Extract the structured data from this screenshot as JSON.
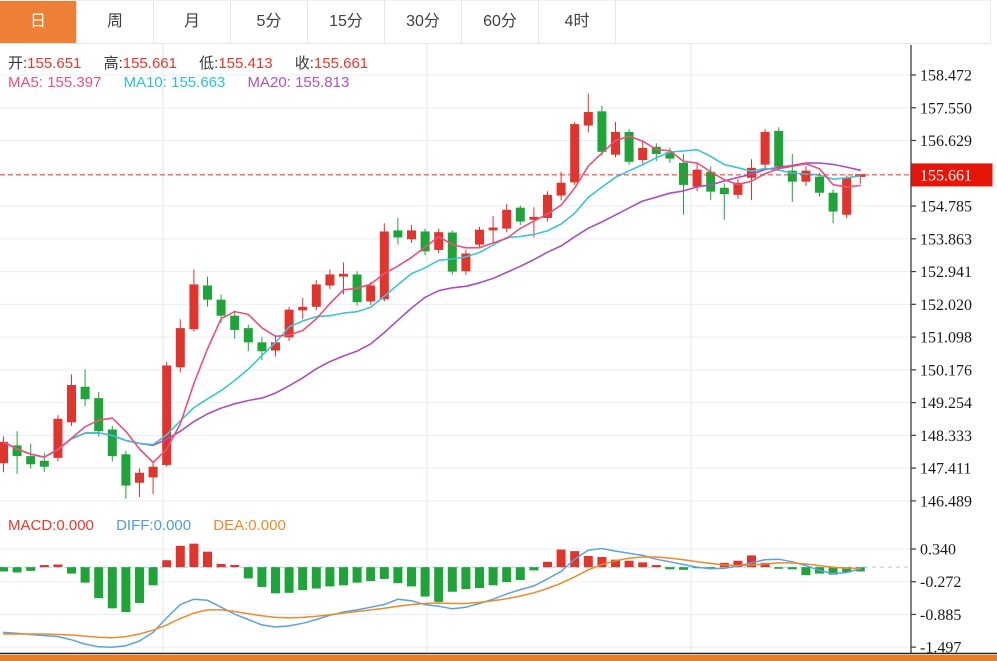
{
  "tabs": {
    "items": [
      {
        "key": "day",
        "label": "日",
        "active": true
      },
      {
        "key": "week",
        "label": "周",
        "active": false
      },
      {
        "key": "month",
        "label": "月",
        "active": false
      },
      {
        "key": "5min",
        "label": "5分",
        "active": false
      },
      {
        "key": "15min",
        "label": "15分",
        "active": false
      },
      {
        "key": "30min",
        "label": "30分",
        "active": false
      },
      {
        "key": "60min",
        "label": "60分",
        "active": false
      },
      {
        "key": "4hour",
        "label": "4时",
        "active": false
      }
    ]
  },
  "legend": {
    "open_label": "开:",
    "open_value": "155.651",
    "high_label": "高:",
    "high_value": "155.661",
    "low_label": "低:",
    "low_value": "155.413",
    "close_label": "收:",
    "close_value": "155.661",
    "ma5_label": "MA5: ",
    "ma5_value": "155.397",
    "ma10_label": "MA10: ",
    "ma10_value": "155.663",
    "ma20_label": "MA20: ",
    "ma20_value": "155.813"
  },
  "macd_legend": {
    "macd_label": "MACD:",
    "macd_value": "0.000",
    "diff_label": "DIFF:",
    "diff_value": "0.000",
    "dea_label": "DEA:",
    "dea_value": "0.000"
  },
  "colors": {
    "up": "#e0342c",
    "down": "#1fa439",
    "ma5": "#ee4f7c",
    "ma10": "#3bc4da",
    "ma20": "#aa4fc0",
    "diff": "#5aa2e6",
    "dea": "#ef8b26",
    "grid_h": "#e9eef6",
    "grid_v": "#dce6f4",
    "axis": "#3c3c3c",
    "axis_text": "#1b1b1b",
    "current_line": "#e23b31",
    "tag_red": "#e61507",
    "tag_text": "#ffffff",
    "zero_dash": "#a5d9ef",
    "accent_orange": "#ee7c1c",
    "bottom_border": "#222222"
  },
  "chart_data": {
    "type": "candlestick",
    "title": "",
    "legend_position": "top-left",
    "grid": true,
    "main": {
      "ylim": [
        146.489,
        158.472
      ],
      "tick_prices": [
        158.472,
        157.55,
        156.629,
        155.707,
        154.785,
        153.863,
        152.941,
        152.02,
        151.098,
        150.176,
        149.254,
        148.333,
        147.411,
        146.489
      ],
      "tick_labels": [
        "158.472",
        "157.550",
        "156.629",
        "",
        "154.785",
        "153.863",
        "152.941",
        "152.020",
        "151.098",
        "150.176",
        "149.254",
        "148.333",
        "147.411",
        "146.489"
      ],
      "current_price": 155.661,
      "current_price_label": "155.661",
      "candles_format": [
        "open",
        "high",
        "low",
        "close"
      ],
      "candles": [
        [
          147.55,
          148.3,
          147.3,
          148.15
        ],
        [
          148.05,
          148.45,
          147.25,
          147.75
        ],
        [
          147.75,
          148.1,
          147.4,
          147.52
        ],
        [
          147.62,
          147.85,
          147.3,
          147.45
        ],
        [
          147.7,
          148.9,
          147.6,
          148.8
        ],
        [
          148.7,
          150.05,
          148.6,
          149.75
        ],
        [
          149.7,
          150.18,
          149.15,
          149.35
        ],
        [
          149.38,
          149.55,
          148.3,
          148.45
        ],
        [
          148.5,
          148.6,
          147.6,
          147.75
        ],
        [
          147.8,
          147.9,
          146.55,
          146.92
        ],
        [
          147.0,
          147.4,
          146.6,
          147.28
        ],
        [
          147.15,
          147.55,
          146.68,
          147.45
        ],
        [
          147.5,
          150.4,
          147.45,
          150.3
        ],
        [
          150.25,
          151.6,
          150.1,
          151.35
        ],
        [
          151.32,
          153.0,
          151.25,
          152.58
        ],
        [
          152.55,
          152.8,
          151.95,
          152.15
        ],
        [
          152.15,
          152.3,
          151.5,
          151.7
        ],
        [
          151.7,
          151.85,
          151.05,
          151.3
        ],
        [
          151.35,
          151.45,
          150.7,
          150.95
        ],
        [
          150.95,
          151.1,
          150.45,
          150.7
        ],
        [
          150.72,
          151.15,
          150.55,
          150.95
        ],
        [
          151.09,
          151.95,
          150.99,
          151.87
        ],
        [
          151.85,
          152.2,
          151.6,
          151.95
        ],
        [
          151.95,
          152.7,
          151.85,
          152.58
        ],
        [
          152.55,
          153.0,
          152.45,
          152.86
        ],
        [
          152.8,
          153.2,
          152.3,
          152.88
        ],
        [
          152.86,
          152.95,
          151.98,
          152.08
        ],
        [
          152.1,
          152.65,
          152.0,
          152.55
        ],
        [
          152.16,
          154.3,
          152.1,
          154.07
        ],
        [
          154.1,
          154.45,
          153.7,
          153.9
        ],
        [
          153.85,
          154.25,
          153.75,
          154.1
        ],
        [
          154.07,
          154.15,
          153.4,
          153.51
        ],
        [
          153.55,
          154.15,
          153.45,
          154.05
        ],
        [
          154.04,
          154.1,
          152.85,
          152.94
        ],
        [
          152.95,
          153.55,
          152.85,
          153.45
        ],
        [
          153.7,
          154.2,
          153.6,
          154.12
        ],
        [
          154.1,
          154.5,
          153.75,
          154.18
        ],
        [
          154.15,
          154.85,
          154.05,
          154.68
        ],
        [
          154.74,
          154.8,
          154.25,
          154.35
        ],
        [
          154.4,
          154.75,
          153.9,
          154.48
        ],
        [
          154.45,
          155.2,
          154.35,
          155.1
        ],
        [
          155.08,
          155.75,
          154.95,
          155.44
        ],
        [
          155.45,
          157.15,
          155.38,
          157.09
        ],
        [
          157.05,
          157.95,
          156.85,
          157.43
        ],
        [
          157.45,
          157.6,
          156.2,
          156.31
        ],
        [
          156.23,
          157.15,
          156.15,
          156.87
        ],
        [
          156.87,
          156.95,
          155.95,
          156.03
        ],
        [
          156.08,
          156.6,
          155.98,
          156.42
        ],
        [
          156.45,
          156.55,
          156.05,
          156.25
        ],
        [
          156.3,
          156.42,
          156.0,
          156.12
        ],
        [
          156.0,
          156.25,
          154.54,
          155.38
        ],
        [
          155.33,
          156.0,
          155.2,
          155.81
        ],
        [
          155.75,
          155.9,
          154.95,
          155.19
        ],
        [
          155.3,
          155.42,
          154.4,
          155.12
        ],
        [
          155.1,
          155.55,
          154.98,
          155.44
        ],
        [
          155.58,
          156.1,
          154.95,
          155.86
        ],
        [
          155.95,
          156.95,
          155.85,
          156.87
        ],
        [
          156.9,
          157.0,
          155.8,
          155.89
        ],
        [
          155.78,
          156.25,
          154.9,
          155.47
        ],
        [
          155.47,
          155.9,
          155.35,
          155.78
        ],
        [
          155.61,
          155.72,
          155.05,
          155.16
        ],
        [
          155.16,
          155.25,
          154.3,
          154.63
        ],
        [
          154.54,
          155.65,
          154.44,
          155.58
        ],
        [
          155.651,
          155.661,
          155.413,
          155.661
        ]
      ],
      "ma_windows": {
        "ma5": 5,
        "ma10": 10,
        "ma20": 20
      }
    },
    "macd": {
      "ylim": [
        -1.75,
        0.65
      ],
      "tick_values": [
        0.34,
        -0.272,
        -0.885,
        -1.497
      ],
      "tick_labels": [
        "0.340",
        "-0.272",
        "-0.885",
        "-1.497"
      ],
      "histogram": [
        -0.08,
        -0.1,
        -0.07,
        0.04,
        0.05,
        -0.12,
        -0.29,
        -0.58,
        -0.77,
        -0.84,
        -0.67,
        -0.34,
        0.13,
        0.4,
        0.44,
        0.29,
        0.06,
        0.04,
        -0.21,
        -0.37,
        -0.49,
        -0.48,
        -0.43,
        -0.4,
        -0.36,
        -0.34,
        -0.29,
        -0.26,
        -0.22,
        -0.3,
        -0.36,
        -0.55,
        -0.65,
        -0.46,
        -0.41,
        -0.39,
        -0.34,
        -0.28,
        -0.24,
        -0.06,
        0.1,
        0.33,
        0.3,
        0.21,
        0.19,
        0.14,
        0.12,
        0.09,
        0.04,
        -0.04,
        -0.05,
        -0.02,
        -0.02,
        0.08,
        0.12,
        0.22,
        0.08,
        -0.03,
        -0.04,
        -0.15,
        -0.12,
        -0.14,
        -0.1,
        -0.08
      ],
      "diff": [
        -1.22,
        -1.24,
        -1.26,
        -1.28,
        -1.3,
        -1.36,
        -1.44,
        -1.49,
        -1.5,
        -1.47,
        -1.38,
        -1.22,
        -0.95,
        -0.7,
        -0.6,
        -0.62,
        -0.75,
        -0.88,
        -0.98,
        -1.08,
        -1.12,
        -1.1,
        -1.05,
        -0.98,
        -0.9,
        -0.84,
        -0.8,
        -0.75,
        -0.7,
        -0.6,
        -0.63,
        -0.7,
        -0.73,
        -0.78,
        -0.75,
        -0.68,
        -0.6,
        -0.5,
        -0.42,
        -0.35,
        -0.22,
        -0.08,
        0.15,
        0.32,
        0.35,
        0.3,
        0.26,
        0.22,
        0.15,
        0.1,
        0.05,
        0.0,
        -0.03,
        -0.02,
        0.02,
        0.08,
        0.14,
        0.15,
        0.1,
        0.03,
        -0.06,
        -0.12,
        -0.1,
        -0.03
      ],
      "dea": [
        -1.25,
        -1.25,
        -1.25,
        -1.25,
        -1.26,
        -1.27,
        -1.29,
        -1.31,
        -1.32,
        -1.3,
        -1.25,
        -1.18,
        -1.08,
        -0.96,
        -0.86,
        -0.8,
        -0.8,
        -0.83,
        -0.87,
        -0.91,
        -0.94,
        -0.95,
        -0.94,
        -0.92,
        -0.89,
        -0.86,
        -0.83,
        -0.8,
        -0.77,
        -0.73,
        -0.7,
        -0.68,
        -0.67,
        -0.68,
        -0.68,
        -0.66,
        -0.63,
        -0.59,
        -0.54,
        -0.48,
        -0.4,
        -0.3,
        -0.18,
        -0.05,
        0.05,
        0.12,
        0.17,
        0.19,
        0.19,
        0.17,
        0.14,
        0.1,
        0.07,
        0.04,
        0.03,
        0.04,
        0.06,
        0.08,
        0.08,
        0.06,
        0.03,
        0.0,
        -0.02,
        -0.02
      ]
    }
  }
}
